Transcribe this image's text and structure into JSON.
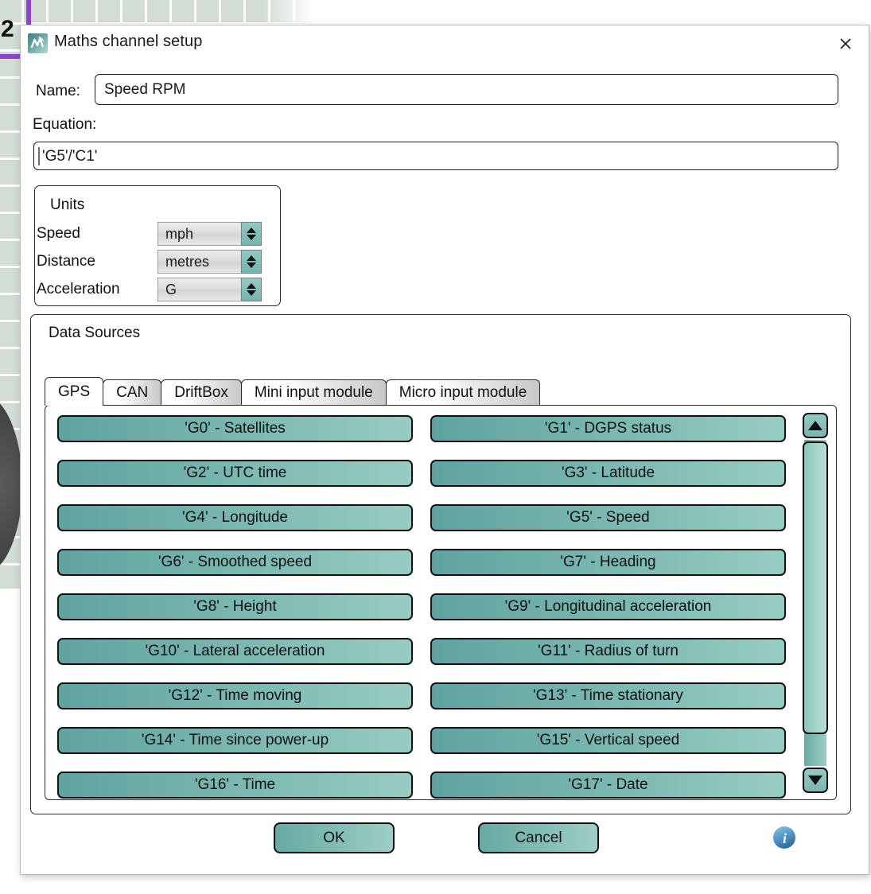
{
  "background": {
    "row_number": "2"
  },
  "dialog": {
    "title": "Maths channel setup",
    "app_icon": "maths-channel-icon",
    "close_icon": "close-icon"
  },
  "name_field": {
    "label": "Name:",
    "value": "Speed RPM",
    "placeholder": ""
  },
  "equation_field": {
    "label": "Equation:",
    "value": "'G5'/'C1'",
    "placeholder": ""
  },
  "units": {
    "legend": "Units",
    "rows": [
      {
        "label": "Speed",
        "value": "mph"
      },
      {
        "label": "Distance",
        "value": "metres"
      },
      {
        "label": "Acceleration",
        "value": "G"
      }
    ]
  },
  "data_sources": {
    "legend": "Data Sources",
    "tabs": [
      {
        "label": "GPS",
        "active": true
      },
      {
        "label": "CAN",
        "active": false
      },
      {
        "label": "DriftBox",
        "active": false
      },
      {
        "label": "Mini input module",
        "active": false
      },
      {
        "label": "Micro input module",
        "active": false
      }
    ],
    "channels": [
      "'G0' - Satellites",
      "'G1' - DGPS status",
      "'G2' - UTC time",
      "'G3' - Latitude",
      "'G4' - Longitude",
      "'G5' - Speed",
      "'G6' - Smoothed speed",
      "'G7' - Heading",
      "'G8' - Height",
      "'G9' - Longitudinal acceleration",
      "'G10' - Lateral acceleration",
      "'G11' - Radius of turn",
      "'G12' - Time moving",
      "'G13' - Time stationary",
      "'G14' - Time since power-up",
      "'G15' - Vertical speed",
      "'G16' - Time",
      "'G17' - Date"
    ],
    "scrollbar": {
      "up_icon": "scroll-up-arrow-icon",
      "down_icon": "scroll-down-arrow-icon"
    }
  },
  "footer": {
    "ok_label": "OK",
    "cancel_label": "Cancel",
    "info_icon": "info-icon"
  },
  "colors": {
    "teal_dark": "#5fa3a0",
    "teal_light": "#97ccc2",
    "info_blue": "#4a90c4",
    "grid_green": "#d2ddd4",
    "accent_purple": "#8e44d0"
  }
}
